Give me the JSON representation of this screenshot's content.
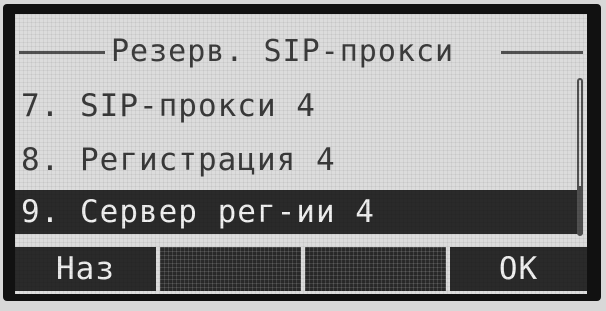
{
  "header": {
    "title": "Резерв. SIP-прокси"
  },
  "menu": {
    "items": [
      {
        "label": "7. SIP-прокси 4",
        "selected": false
      },
      {
        "label": "8. Регистрация 4",
        "selected": false
      },
      {
        "label": "9. Сервер рег-ии 4",
        "selected": true
      }
    ]
  },
  "softkeys": {
    "back_label": "Наз",
    "key2_label": "",
    "key3_label": "",
    "ok_label": "OK"
  },
  "scrollbar": {
    "position_fraction": 0.7
  },
  "colors": {
    "lcd_background": "#dcdcdc",
    "lcd_text": "#3a3a3a",
    "highlight_background": "#2a2a2a",
    "highlight_text": "#f0f0f0"
  }
}
